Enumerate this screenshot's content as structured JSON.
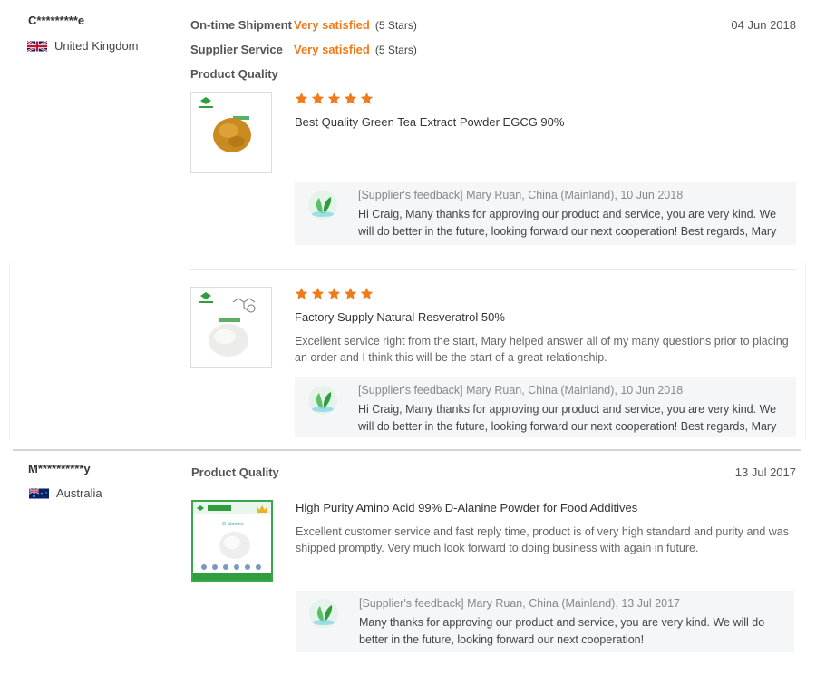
{
  "reviews": [
    {
      "reviewer": "C*********e",
      "country": "United Kingdom",
      "date": "04 Jun 2018",
      "ratings": [
        {
          "label": "On-time Shipment",
          "value": "Very satisfied",
          "stars_text": "(5 Stars)"
        },
        {
          "label": "Supplier Service",
          "value": "Very satisfied",
          "stars_text": "(5 Stars)"
        }
      ],
      "product_quality_label": "Product Quality",
      "products": [
        {
          "stars": 5,
          "title": "Best Quality Green Tea Extract Powder EGCG 90%",
          "text": "",
          "feedback_head": "[Supplier's feedback] Mary Ruan, China (Mainland), 10 Jun 2018",
          "feedback_body": "Hi Craig, Many thanks for approving our product and service, you are very kind. We will do better in the future, looking forward our next cooperation! Best regards, Mary"
        },
        {
          "stars": 5,
          "title": "Factory Supply Natural Resveratrol 50%",
          "text": "Excellent service right from the start, Mary helped answer all of my many questions prior to placing an order and I think this will be the start of a great relationship.",
          "feedback_head": "[Supplier's feedback] Mary Ruan, China (Mainland), 10 Jun 2018",
          "feedback_body": "Hi Craig, Many thanks for approving our product and service, you are very kind. We will do better in the future, looking forward our next cooperation! Best regards, Mary"
        }
      ]
    },
    {
      "reviewer": "M**********y",
      "country": "Australia",
      "date": "13 Jul 2017",
      "product_quality_label": "Product Quality",
      "products": [
        {
          "title": "High Purity Amino Acid 99% D-Alanine Powder for Food Additives",
          "text": "Excellent customer service and fast reply time, product is of very high standard and purity and was shipped promptly. Very much look forward to doing business with again in future.",
          "image_caption": "D-alanine",
          "feedback_head": "[Supplier's feedback] Mary Ruan, China (Mainland), 13 Jul 2017",
          "feedback_body": "Many thanks for approving our product and service, you are very kind. We will do better in the future, looking forward our next cooperation!"
        }
      ]
    }
  ],
  "colors": {
    "accent": "#f07b1d",
    "feedback_bg": "#f5f6f7",
    "brand_green": "#2e9e3e"
  }
}
